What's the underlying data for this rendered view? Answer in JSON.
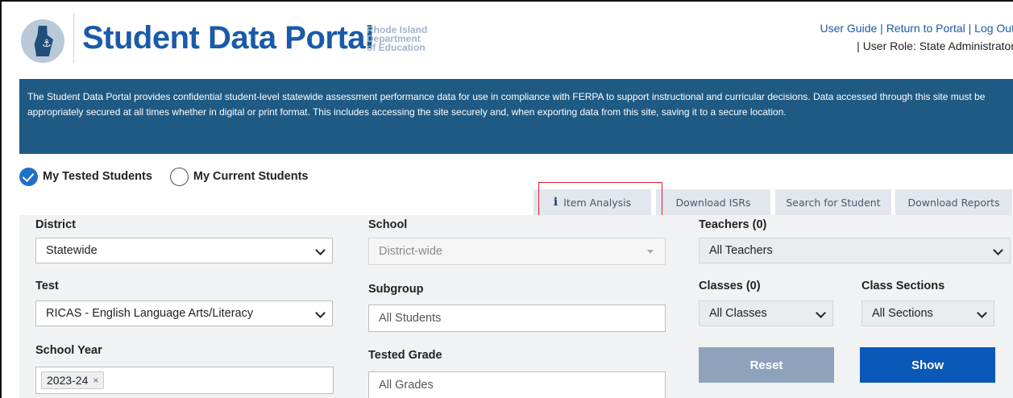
{
  "header": {
    "title": "Student Data Portal",
    "org_line1": "Rhode Island",
    "org_line2": "Department",
    "org_line3": "of Education",
    "links": {
      "user_guide": "User Guide",
      "return_portal": "Return to Portal",
      "log_out": "Log Out",
      "separator": "|"
    },
    "user_role": "| User Role: State Administrator"
  },
  "banner": {
    "text": "The Student Data Portal provides confidential student-level statewide assessment performance data for use in compliance with FERPA to support instructional and curricular decisions. Data accessed through this site must be appropriately secured at all times whether in digital or print format. This includes accessing the site securely and, when exporting data from this site, saving it to a secure location."
  },
  "radios": {
    "tested": "My Tested Students",
    "current": "My Current Students",
    "selected": "tested"
  },
  "tabs": {
    "item_analysis": "Item Analysis",
    "download_isrs": "Download ISRs",
    "search_student": "Search for Student",
    "download_reports": "Download Reports"
  },
  "form": {
    "district": {
      "label": "District",
      "value": "Statewide"
    },
    "school": {
      "label": "School",
      "value": "District-wide"
    },
    "teachers": {
      "label": "Teachers (0)",
      "value": "All Teachers"
    },
    "test": {
      "label": "Test",
      "value": "RICAS - English Language Arts/Literacy"
    },
    "subgroup": {
      "label": "Subgroup",
      "value": "All Students"
    },
    "classes": {
      "label": "Classes (0)",
      "value": "All Classes"
    },
    "class_sections": {
      "label": "Class Sections",
      "value": "All Sections"
    },
    "school_year": {
      "label": "School Year",
      "tag": "2023-24",
      "remove": "×"
    },
    "tested_grade": {
      "label": "Tested Grade",
      "value": "All Grades"
    },
    "reset": "Reset",
    "show": "Show"
  },
  "colors": {
    "brand": "#1a5aa8",
    "banner": "#1f5a84",
    "radio_checked": "#1f6fc5",
    "show_button": "#0a58b8",
    "reset_button": "#8fa2bc",
    "highlight": "#e0202a"
  }
}
